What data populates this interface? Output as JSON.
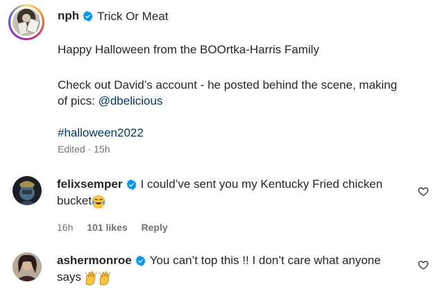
{
  "post": {
    "username": "nph",
    "title": "Trick Or Meat",
    "caption_1": "Happy Halloween from the BOOrtka-Harris Family",
    "caption_2a": "Check out David’s account - he posted behind the scene, making",
    "caption_2b": "of pics: ",
    "mention": "@dbelicious",
    "hashtag": "#halloween2022",
    "meta": "Edited · 15h"
  },
  "comments": [
    {
      "username": "felixsemper",
      "text_1": "I could’ve sent you my Kentucky Fried chicken",
      "text_2": "bucket",
      "emoji": "face-with-tears-of-joy",
      "time": "16h",
      "likes": "101 likes",
      "reply": "Reply"
    },
    {
      "username": "ashermonroe",
      "text_1": "You can’t top this !! I don’t care what anyone",
      "text_2": "says",
      "emoji": "raising-hands-x2",
      "time": "",
      "likes": "",
      "reply": ""
    }
  ],
  "colors": {
    "verified": "#0095f6",
    "link": "#00376b",
    "meta": "#737373"
  }
}
